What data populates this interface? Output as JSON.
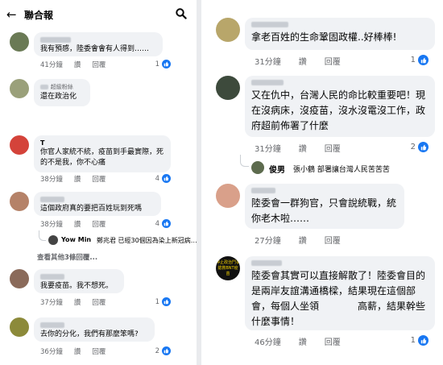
{
  "left": {
    "header": {
      "title": "聯合報",
      "back_icon": "arrow-left-icon",
      "search_icon": "search-icon"
    },
    "comments": [
      {
        "text": "我有預感，陸委會會有人得到……",
        "time": "41分鐘",
        "like": "讚",
        "reply": "回覆",
        "count": "1"
      },
      {
        "badge": "超級粉絲",
        "text": "還在政治化",
        "time": "41分鐘",
        "like": "讚",
        "reply": "回覆",
        "count": ""
      },
      {
        "name": "T",
        "text": "你官人家統不統，疫苗到手最實際，死的不是我，你不心痛",
        "time": "38分鐘",
        "like": "讚",
        "reply": "回覆",
        "count": "4"
      },
      {
        "text": "這個政府真的要把百姓玩到死嗎",
        "time": "38分鐘",
        "like": "讚",
        "reply": "回覆",
        "count": "4"
      },
      {
        "text": "我要疫苗。我不想死。",
        "time": "37分鐘",
        "like": "讚",
        "reply": "回覆",
        "count": "1"
      },
      {
        "text": "去你的分化，我們有那麼笨嗎?",
        "time": "36分鐘",
        "like": "讚",
        "reply": "回覆",
        "count": "2"
      }
    ],
    "sub_reply": {
      "name": "Yow Min",
      "text": "鄭兆君 已經30個因為染上新冠病…"
    },
    "more_replies": "查看其他3條回覆..."
  },
  "right": {
    "comments": [
      {
        "text": "拿老百姓的生命鞏固政權..好棒棒!",
        "time": "31分鐘",
        "like": "讚",
        "reply": "回覆",
        "count": "1"
      },
      {
        "text": "又在仇中，台灣人民的命比較重要吧！現在沒病床，沒疫苗，沒水沒電沒工作，政府超前佈署了什麼",
        "time": "31分鐘",
        "like": "讚",
        "reply": "回覆",
        "count": "2"
      },
      {
        "text": "陸委會一群狗官，只會說統戰，統你老木啦……",
        "time": "27分鐘",
        "like": "讚",
        "reply": "回覆",
        "count": ""
      },
      {
        "text": "陸委會其實可以直接解散了！陸委會目的是兩岸友誼溝通橋樑，結果現在這個部會，每個人坐領　　　　高薪，結果幹些什麼事情！",
        "time": "46分鐘",
        "like": "讚",
        "reply": "回覆",
        "count": "1"
      }
    ],
    "sub_reply": {
      "name": "俊男",
      "text": "張小鶴 部署讓台灣人民苦苦苦"
    },
    "avatar4_text": "停止政治鬥爭 搶救BNT疫苗"
  },
  "colors": {
    "accent": "#1877f2",
    "bubble": "#f0f2f5",
    "meta": "#65676b"
  }
}
